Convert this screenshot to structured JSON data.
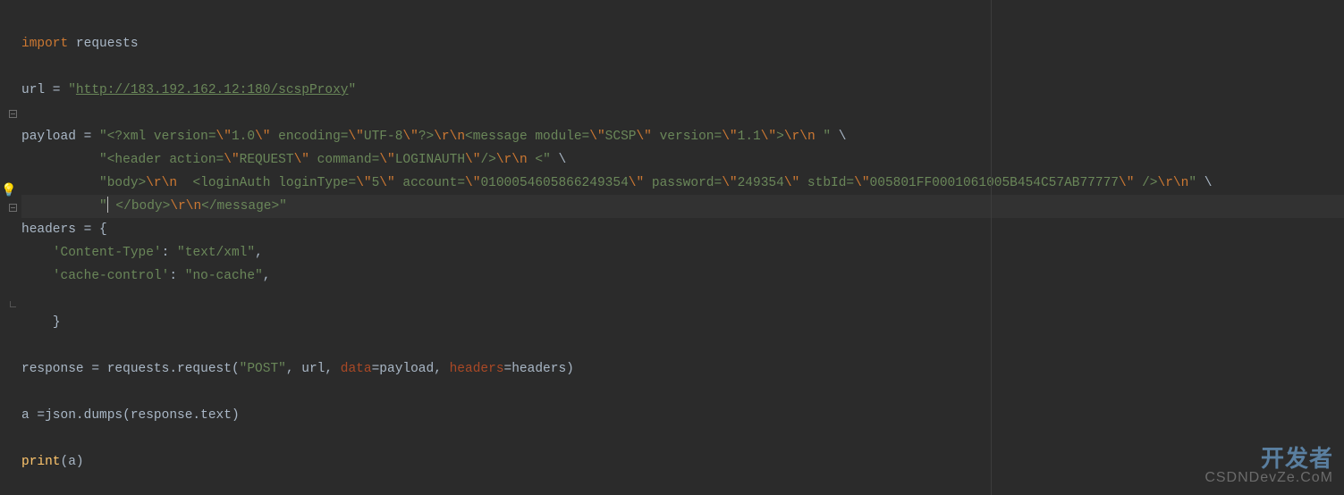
{
  "code": {
    "line1_import": "import",
    "line1_requests": " requests",
    "line3a": "url = ",
    "line3_q1": "\"",
    "line3_url": "http://183.192.162.12:180/scspProxy",
    "line3_q2": "\"",
    "line5a": "payload = ",
    "line5b": "\"<?xml version=",
    "line5esc1": "\\\"",
    "line5c": "1.0",
    "line5esc2": "\\\"",
    "line5d": " encoding=",
    "line5esc3": "\\\"",
    "line5e": "UTF-8",
    "line5esc4": "\\\"",
    "line5f": "?>",
    "line5esc5": "\\r\\n",
    "line5g": "<message module=",
    "line5esc6": "\\\"",
    "line5h": "SCSP",
    "line5esc7": "\\\"",
    "line5i": " version=",
    "line5esc8": "\\\"",
    "line5j": "1.1",
    "line5esc9": "\\\"",
    "line5k": ">",
    "line5esc10": "\\r\\n",
    "line5l": " \"",
    "line5m": " \\",
    "line6pad": "          ",
    "line6a": "\"<header action=",
    "line6esc1": "\\\"",
    "line6b": "REQUEST",
    "line6esc2": "\\\"",
    "line6c": " command=",
    "line6esc3": "\\\"",
    "line6d": "LOGINAUTH",
    "line6esc4": "\\\"",
    "line6e": "/>",
    "line6esc5": "\\r\\n",
    "line6f": " <\"",
    "line6g": " \\",
    "line7pad": "          ",
    "line7a": "\"body>",
    "line7esc1": "\\r\\n",
    "line7b": "  <loginAuth loginType=",
    "line7esc2": "\\\"",
    "line7c": "5",
    "line7esc3": "\\\"",
    "line7d": " account=",
    "line7esc4": "\\\"",
    "line7e": "0100054605866249354",
    "line7esc5": "\\\"",
    "line7f": " password=",
    "line7esc6": "\\\"",
    "line7g": "249354",
    "line7esc7": "\\\"",
    "line7h": " stbId=",
    "line7esc8": "\\\"",
    "line7i": "005801FF0001061005B454C57AB77777",
    "line7esc9": "\\\"",
    "line7j": " />",
    "line7esc10": "\\r\\n",
    "line7k": "\"",
    "line7l": " \\",
    "line8pad": "          ",
    "line8a": "\"",
    "line8b": " </body>",
    "line8esc1": "\\r\\n",
    "line8c": "</message>\"",
    "line9a": "headers = {",
    "line10pad": "    ",
    "line10a": "'Content-Type'",
    "line10b": ": ",
    "line10c": "\"text/xml\"",
    "line10d": ",",
    "line11pad": "    ",
    "line11a": "'cache-control'",
    "line11b": ": ",
    "line11c": "\"no-cache\"",
    "line11d": ",",
    "line13pad": "    ",
    "line13a": "}",
    "line15a": "response = requests.request(",
    "line15b": "\"POST\"",
    "line15c": ", url, ",
    "line15d": "data",
    "line15e": "=payload, ",
    "line15f": "headers",
    "line15g": "=headers)",
    "line17a": "a =json.dumps(response.text)",
    "line19a": "print",
    "line19b": "(a)"
  },
  "watermark": {
    "top": "开发者",
    "bottom": "CSDNDevZe.CoM"
  }
}
